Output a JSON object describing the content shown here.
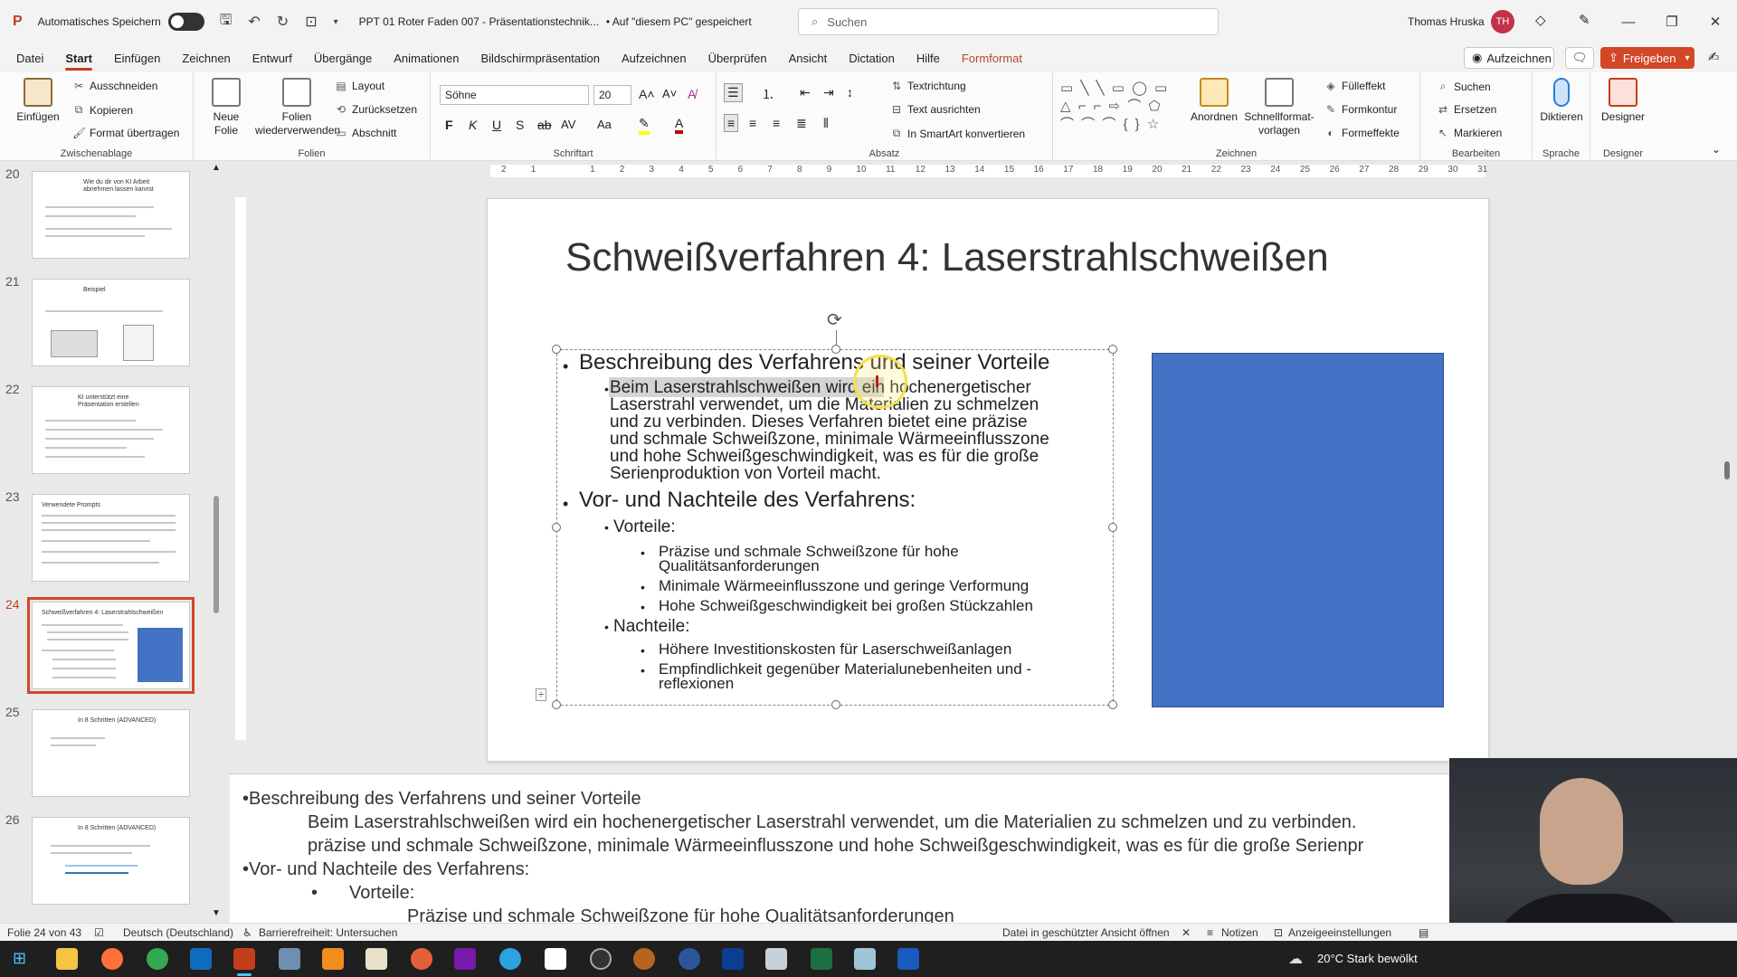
{
  "titlebar": {
    "autosave_label": "Automatisches Speichern",
    "doc_title": "PPT 01 Roter Faden 007 - Präsentationstechnik...",
    "save_state": "• Auf \"diesem PC\" gespeichert",
    "search_placeholder": "Suchen",
    "user_name": "Thomas Hruska",
    "user_initials": "TH"
  },
  "tabs": [
    "Datei",
    "Start",
    "Einfügen",
    "Zeichnen",
    "Entwurf",
    "Übergänge",
    "Animationen",
    "Bildschirmpräsentation",
    "Aufzeichnen",
    "Überprüfen",
    "Ansicht",
    "Dictation",
    "Hilfe",
    "Formformat"
  ],
  "active_tab": "Start",
  "tab_buttons": {
    "record": "Aufzeichnen",
    "share": "Freigeben"
  },
  "ribbon": {
    "clipboard": {
      "paste": "Einfügen",
      "cut": "Ausschneiden",
      "copy": "Kopieren",
      "format_painter": "Format übertragen",
      "label": "Zwischenablage"
    },
    "slides": {
      "new_slide": "Neue Folie",
      "reuse": "Folien wiederverwenden",
      "layout": "Layout",
      "reset": "Zurücksetzen",
      "section": "Abschnitt",
      "label": "Folien"
    },
    "font": {
      "name": "Söhne",
      "size": "20",
      "bold": "F",
      "italic": "K",
      "underline": "U",
      "strike": "S",
      "label": "Schriftart"
    },
    "paragraph": {
      "text_direction": "Textrichtung",
      "align_text": "Text ausrichten",
      "smartart": "In SmartArt konvertieren",
      "label": "Absatz"
    },
    "drawing": {
      "arrange": "Anordnen",
      "quick_styles": "Schnellformat-vorlagen",
      "fill": "Fülleffekt",
      "outline": "Formkontur",
      "effects": "Formeffekte",
      "label": "Zeichnen"
    },
    "editing": {
      "find": "Suchen",
      "replace": "Ersetzen",
      "select": "Markieren",
      "label": "Bearbeiten"
    },
    "voice": {
      "dictate": "Diktieren",
      "label": "Sprache"
    },
    "designer": {
      "designer": "Designer",
      "label": "Designer"
    }
  },
  "thumbnails": [
    {
      "num": "20",
      "title": "Wie du dir von KI Arbeit abnehmen lassen kannst"
    },
    {
      "num": "21",
      "title": "Beispiel"
    },
    {
      "num": "22",
      "title": "KI unterstützt eine Präsentation erstellen"
    },
    {
      "num": "23",
      "title": "Verwendete Prompts"
    },
    {
      "num": "24",
      "title": "Schweißverfahren 4: Laserstrahlschweißen"
    },
    {
      "num": "25",
      "title": "In 8 Schritten (ADVANCED)"
    },
    {
      "num": "26",
      "title": "In 8 Schritten (ADVANCED)"
    }
  ],
  "slide": {
    "title": "Schweißverfahren 4: Laserstrahlschweißen",
    "b1": "Beschreibung des Verfahrens und seiner Vorteile",
    "b1_lines": [
      "Beim Laserstrahlschweißen wird ein hochenergetischer",
      "Laserstrahl verwendet, um die Materialien zu schmelzen",
      "und zu verbinden. Dieses Verfahren bietet eine präzise",
      "und schmale Schweißzone, minimale Wärmeeinflusszone",
      "und hohe Schweißgeschwindigkeit, was es für die große",
      "Serienproduktion von Vorteil macht."
    ],
    "b2": "Vor- und Nachteile des Verfahrens:",
    "pros": "Vorteile:",
    "pro1_lines": [
      "Präzise und schmale Schweißzone für hohe",
      "Qualitätsanforderungen"
    ],
    "pro2": "Minimale Wärmeeinflusszone und geringe Verformung",
    "pro3": "Hohe Schweißgeschwindigkeit bei großen Stückzahlen",
    "cons": "Nachteile:",
    "con1": "Höhere Investitionskosten für Laserschweißanlagen",
    "con2_lines": [
      "Empfindlichkeit gegenüber Materialunebenheiten und -",
      "reflexionen"
    ]
  },
  "notes": {
    "line1": "•Beschreibung des Verfahrens und seiner Vorteile",
    "line2": "Beim Laserstrahlschweißen wird ein hochenergetischer Laserstrahl verwendet, um die Materialien zu schmelzen und zu verbinden.",
    "line3": "präzise und schmale Schweißzone, minimale Wärmeeinflusszone und hohe Schweißgeschwindigkeit, was es für die große Serienpr",
    "line4": "•Vor- und Nachteile des Verfahrens:",
    "line5_bullet": "•",
    "line5": "Vorteile:",
    "line6": "Präzise und schmale Schweißzone für hohe Qualitätsanforderungen"
  },
  "status": {
    "slide_count": "Folie 24 von 43",
    "language": "Deutsch (Deutschland)",
    "accessibility": "Barrierefreiheit: Untersuchen",
    "protected": "Datei in geschützter Ansicht öffnen",
    "notes": "Notizen",
    "display": "Anzeigeeinstellungen"
  },
  "taskbar": {
    "weather": "20°C  Stark bewölkt"
  },
  "colors": {
    "accent": "#c43e1c",
    "selection": "#d24726",
    "shape_fill": "#4472c4",
    "share_button": "#d24726"
  }
}
